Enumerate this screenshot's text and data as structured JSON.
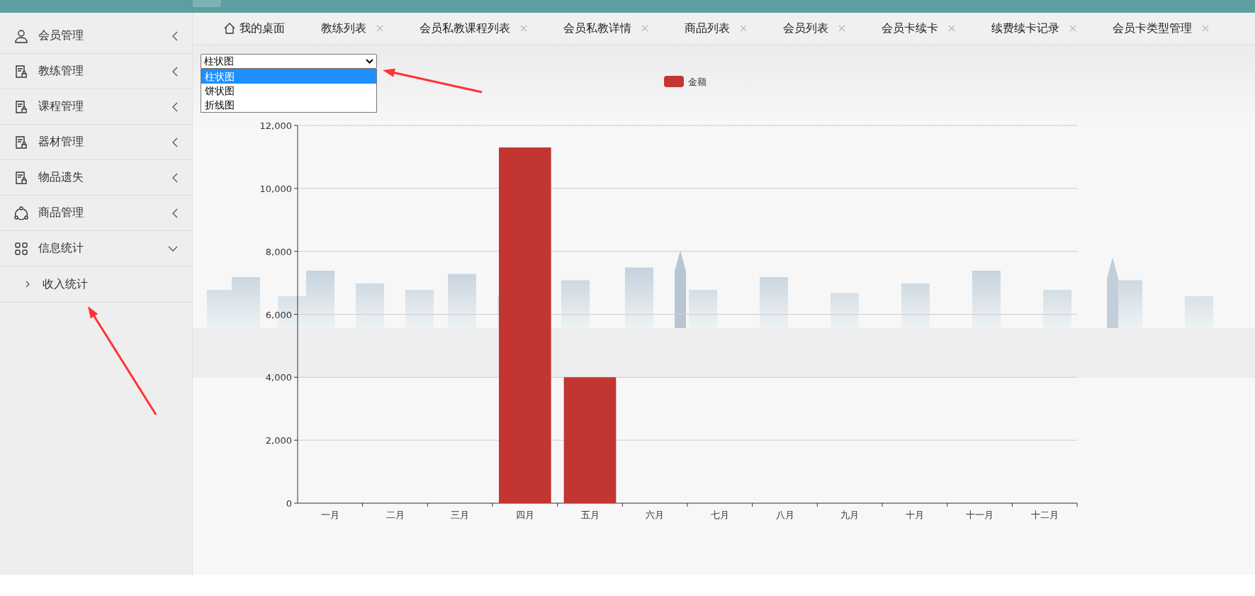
{
  "sidebar": {
    "items": [
      {
        "label": "会员管理",
        "expanded": false
      },
      {
        "label": "教练管理",
        "expanded": false
      },
      {
        "label": "课程管理",
        "expanded": false
      },
      {
        "label": "器材管理",
        "expanded": false
      },
      {
        "label": "物品遗失",
        "expanded": false
      },
      {
        "label": "商品管理",
        "expanded": false
      },
      {
        "label": "信息统计",
        "expanded": true,
        "children": [
          {
            "label": "收入统计",
            "selected": false
          }
        ]
      }
    ]
  },
  "tabs": [
    {
      "label": "我的桌面",
      "kind": "home",
      "selected": false
    },
    {
      "label": "教练列表",
      "kind": "closable",
      "selected": false
    },
    {
      "label": "会员私教课程列表",
      "kind": "closable",
      "selected": false
    },
    {
      "label": "会员私教详情",
      "kind": "closable",
      "selected": false
    },
    {
      "label": "商品列表",
      "kind": "closable",
      "selected": false
    },
    {
      "label": "会员列表",
      "kind": "closable",
      "selected": false
    },
    {
      "label": "会员卡续卡",
      "kind": "closable",
      "selected": false
    },
    {
      "label": "续费续卡记录",
      "kind": "closable",
      "selected": false
    },
    {
      "label": "会员卡类型管理",
      "kind": "closable",
      "selected": false
    }
  ],
  "chart_switcher": {
    "value": "柱状图",
    "open": true,
    "options": [
      {
        "label": "柱状图",
        "selected": true
      },
      {
        "label": "饼状图",
        "selected": false
      },
      {
        "label": "折线图",
        "selected": false
      }
    ]
  },
  "chart_data": {
    "type": "bar",
    "categories": [
      "一月",
      "二月",
      "三月",
      "四月",
      "五月",
      "六月",
      "七月",
      "八月",
      "九月",
      "十月",
      "十一月",
      "十二月"
    ],
    "series": [
      {
        "name": "金额",
        "color": "#c23531",
        "values": [
          0,
          0,
          0,
          11300,
          4000,
          0,
          0,
          0,
          0,
          0,
          0,
          0
        ]
      }
    ],
    "ylim": [
      0,
      12000
    ],
    "grid": true,
    "yticks": [
      {
        "value": 0,
        "label": "0"
      },
      {
        "value": 2000,
        "label": "2,000"
      },
      {
        "value": 4000,
        "label": "4,000"
      },
      {
        "value": 6000,
        "label": "6,000"
      },
      {
        "value": 8000,
        "label": "8,000"
      },
      {
        "value": 10000,
        "label": "10,000"
      },
      {
        "value": 12000,
        "label": "12,000"
      }
    ]
  }
}
